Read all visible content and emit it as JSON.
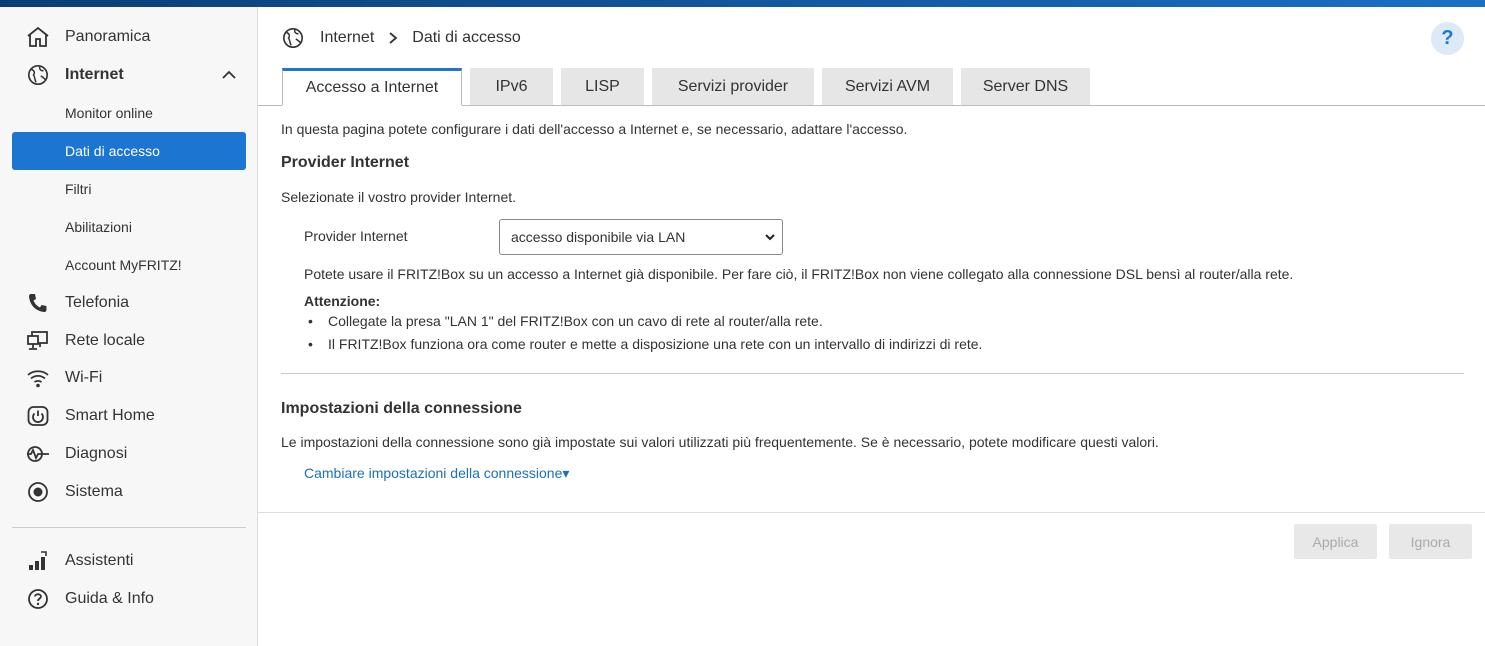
{
  "sidebar": {
    "items": [
      {
        "label": "Panoramica"
      },
      {
        "label": "Internet"
      },
      {
        "label": "Telefonia"
      },
      {
        "label": "Rete locale"
      },
      {
        "label": "Wi-Fi"
      },
      {
        "label": "Smart Home"
      },
      {
        "label": "Diagnosi"
      },
      {
        "label": "Sistema"
      },
      {
        "label": "Assistenti"
      },
      {
        "label": "Guida & Info"
      }
    ],
    "internet_sub": [
      {
        "label": "Monitor online"
      },
      {
        "label": "Dati di accesso"
      },
      {
        "label": "Filtri"
      },
      {
        "label": "Abilitazioni"
      },
      {
        "label": "Account MyFRITZ!"
      }
    ]
  },
  "breadcrumb": {
    "section": "Internet",
    "page": "Dati di accesso"
  },
  "help_label": "?",
  "tabs": [
    {
      "label": "Accesso a Internet"
    },
    {
      "label": "IPv6"
    },
    {
      "label": "LISP"
    },
    {
      "label": "Servizi provider"
    },
    {
      "label": "Servizi AVM"
    },
    {
      "label": "Server DNS"
    }
  ],
  "content": {
    "intro": "In questa pagina potete configurare i dati dell'accesso a Internet e, se necessario, adattare l'accesso.",
    "provider_heading": "Provider Internet",
    "provider_prompt": "Selezionate il vostro provider Internet.",
    "provider_label": "Provider Internet",
    "provider_value": "accesso disponibile via LAN",
    "provider_desc": "Potete usare il FRITZ!Box su un accesso a Internet già disponibile. Per fare ciò, il FRITZ!Box non viene collegato alla connessione DSL bensì al router/alla rete.",
    "attention_label": "Attenzione:",
    "attention_items": [
      "Collegate la presa \"LAN 1\" del FRITZ!Box con un cavo di rete al router/alla rete.",
      "Il FRITZ!Box funziona ora come router e mette a disposizione una rete con un intervallo di indirizzi di rete."
    ],
    "conn_heading": "Impostazioni della connessione",
    "conn_desc": "Le impostazioni della connessione sono già impostate sui valori utilizzati più frequentemente. Se è necessario, potete modificare questi valori.",
    "conn_link": "Cambiare impostazioni della connessione▾"
  },
  "buttons": {
    "apply": "Applica",
    "ignore": "Ignora"
  },
  "colors": {
    "accent": "#1c75d0",
    "topbar": "#0a3d73"
  }
}
